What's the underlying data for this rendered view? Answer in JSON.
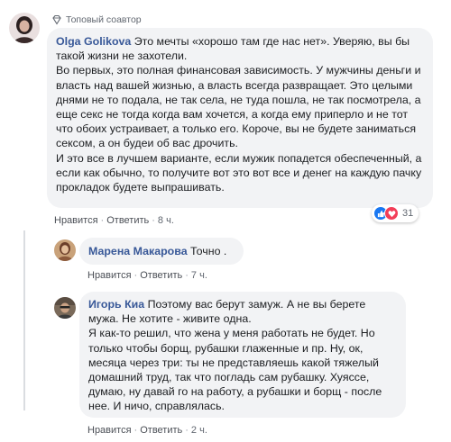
{
  "comments": [
    {
      "badge": "Топовый соавтор",
      "author": "Olga Golikova",
      "paragraphs": [
        "Это мечты «хорошо там где нас нет». Уверяю, вы бы такой жизни не захотели.",
        "Во первых, это полная финансовая зависимость. У мужчины деньги и власть над вашей жизнью, а власть всегда развращает. Это целыми днями не то подала, не так села, не туда пошла, не так посмотрела, а еще секс не тогда когда вам хочется, а когда ему приперло и не тот что обоих устраивает, а только его. Короче, вы не будете заниматься сексом, а он будеи об вас дрочить.",
        "И это все в лучшем варианте, если мужик попадется обеспеченный, а если как обычно, то получите вот это вот все и денег на каждую пачку прокладок будете выпрашивать."
      ],
      "like_label": "Нравится",
      "reply_label": "Ответить",
      "time": "8 ч.",
      "reaction_count": "31"
    },
    {
      "author": "Марена Макарова",
      "paragraphs": [
        "Точно ."
      ],
      "like_label": "Нравится",
      "reply_label": "Ответить",
      "time": "7 ч."
    },
    {
      "author": "Игорь Киа",
      "paragraphs": [
        "Поэтому вас берут замуж. А не вы берете мужа. Не хотите - живите одна.",
        "Я как-то решил, что жена у меня работать не будет. Но только чтобы борщ, рубашки глаженные и пр. Ну, ок, месяца через три: ты не представляешь какой тяжелый домашний труд, так что погладь сам рубашку. Хуяссе, думаю, ну давай го на работу, а рубашки и борщ - после нее. И ничо, справлялась."
      ],
      "like_label": "Нравится",
      "reply_label": "Ответить",
      "time": "2 ч."
    }
  ],
  "colors": {
    "author": "#385898",
    "bubble": "#f2f3f5",
    "meta": "#616770",
    "like": "#1877f2",
    "love": "#f33e58"
  }
}
